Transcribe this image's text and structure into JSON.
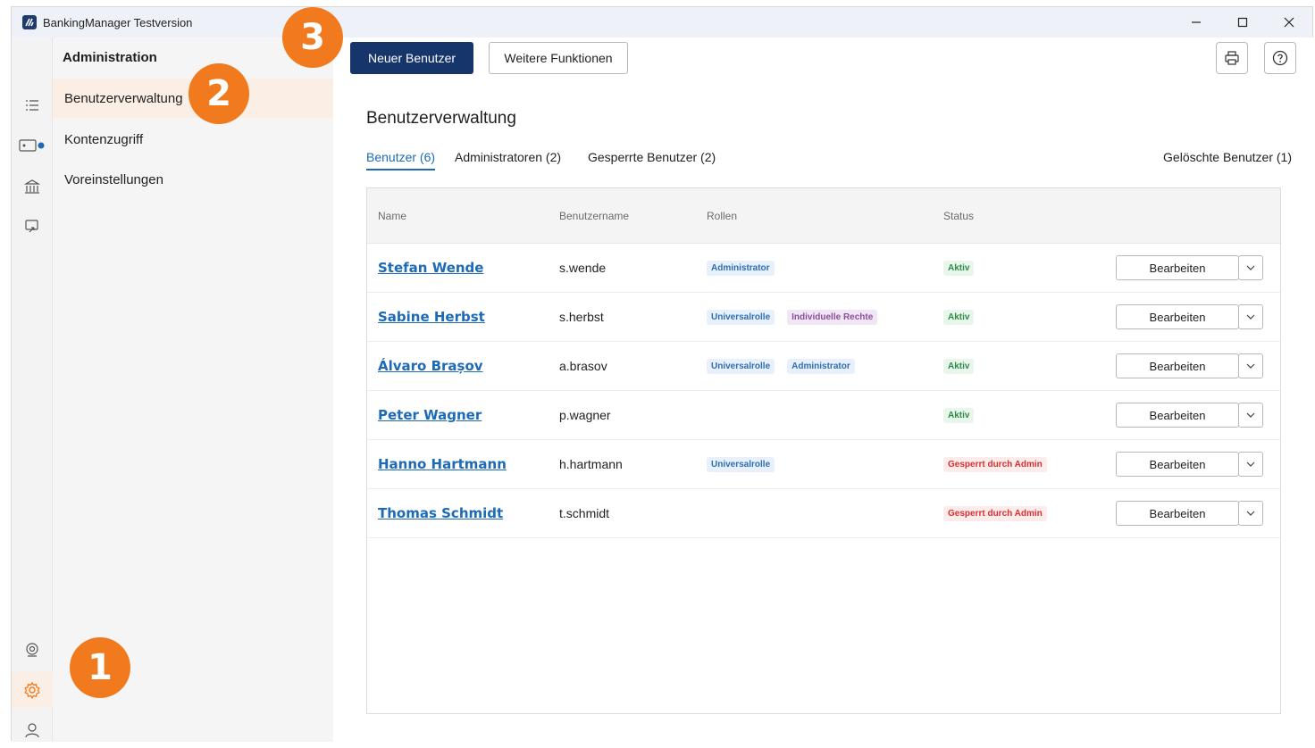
{
  "window": {
    "title": "BankingManager Testversion"
  },
  "nav": {
    "header": "Administration",
    "items": [
      {
        "label": "Benutzerverwaltung"
      },
      {
        "label": "Kontenzugriff"
      },
      {
        "label": "Voreinstellungen"
      }
    ]
  },
  "rail": {
    "icons": [
      "list-icon",
      "account-card-icon",
      "bank-icon",
      "transfer-icon",
      "support-icon",
      "settings-icon",
      "user-icon"
    ],
    "active": "settings-icon"
  },
  "toolbar": {
    "new_user": "Neuer Benutzer",
    "more_functions": "Weitere Funktionen"
  },
  "page": {
    "title": "Benutzerverwaltung",
    "tabs": [
      {
        "label": "Benutzer (6)",
        "active": true
      },
      {
        "label": "Administratoren (2)"
      },
      {
        "label": "Gesperrte Benutzer (2)"
      }
    ],
    "tab_right": "Gelöschte Benutzer (1)"
  },
  "table": {
    "headers": {
      "name": "Name",
      "username": "Benutzername",
      "roles": "Rollen",
      "status": "Status"
    },
    "edit_label": "Bearbeiten",
    "rows": [
      {
        "name": "Stefan Wende",
        "username": "s.wende",
        "roles": [
          "Administrator"
        ],
        "status": "Aktiv"
      },
      {
        "name": "Sabine Herbst",
        "username": "s.herbst",
        "roles": [
          "Universalrolle",
          "Individuelle Rechte"
        ],
        "status": "Aktiv"
      },
      {
        "name": "Álvaro Brașov",
        "username": "a.brasov",
        "roles": [
          "Universalrolle",
          "Administrator"
        ],
        "status": "Aktiv"
      },
      {
        "name": "Peter Wagner",
        "username": "p.wagner",
        "roles": [],
        "status": "Aktiv"
      },
      {
        "name": "Hanno Hartmann",
        "username": "h.hartmann",
        "roles": [
          "Universalrolle"
        ],
        "status": "Gesperrt durch Admin"
      },
      {
        "name": "Thomas Schmidt",
        "username": "t.schmidt",
        "roles": [],
        "status": "Gesperrt durch Admin"
      }
    ]
  },
  "callouts": [
    "1",
    "2",
    "3"
  ],
  "colors": {
    "accent": "#f07a1d",
    "primary": "#16356b",
    "link": "#1d6ab6",
    "active_status": "#2e8a48",
    "locked_status": "#d93030"
  }
}
